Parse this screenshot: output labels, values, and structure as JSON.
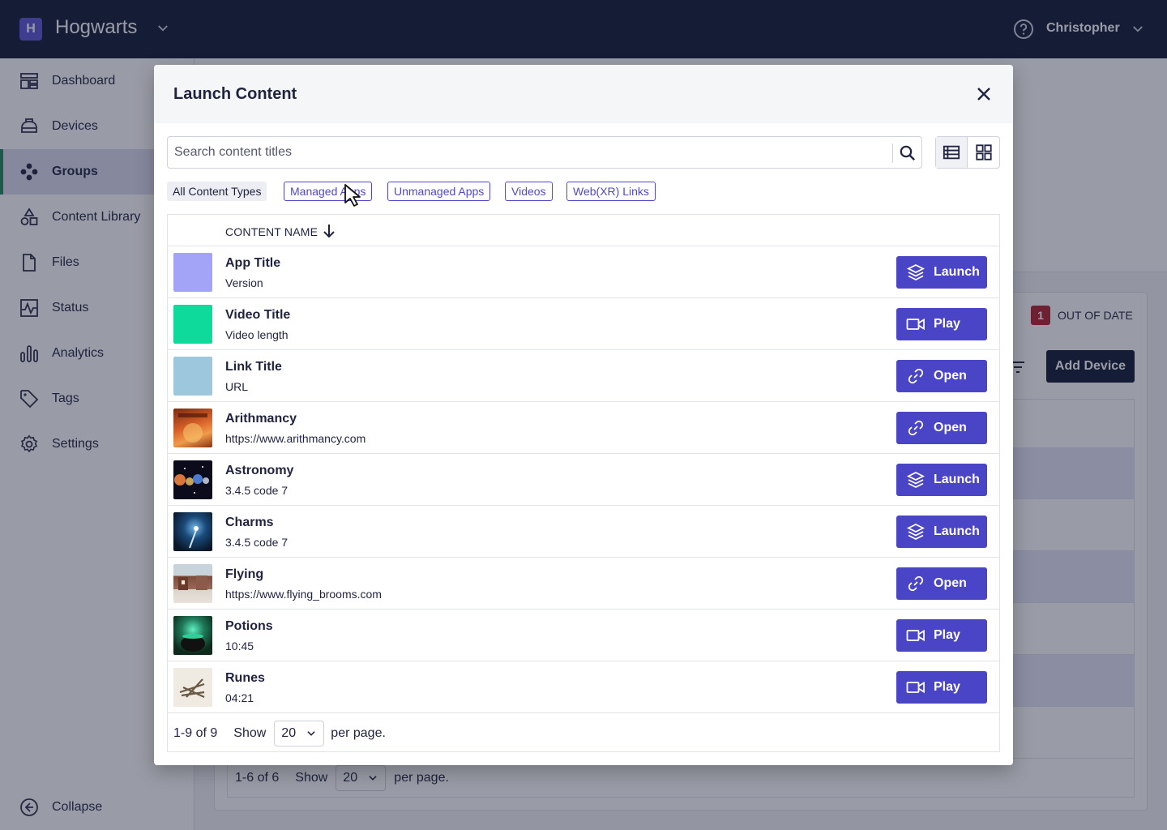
{
  "topbar": {
    "org_initial": "H",
    "org_name": "Hogwarts",
    "user_name": "Christopher"
  },
  "sidebar": {
    "items": [
      {
        "label": "Dashboard",
        "icon": "dashboard-icon"
      },
      {
        "label": "Devices",
        "icon": "devices-icon"
      },
      {
        "label": "Groups",
        "icon": "groups-icon",
        "active": true
      },
      {
        "label": "Content Library",
        "icon": "content-library-icon"
      },
      {
        "label": "Files",
        "icon": "file-icon"
      },
      {
        "label": "Status",
        "icon": "status-icon"
      },
      {
        "label": "Analytics",
        "icon": "analytics-icon"
      },
      {
        "label": "Tags",
        "icon": "tag-icon"
      },
      {
        "label": "Settings",
        "icon": "gear-icon"
      }
    ],
    "collapse_label": "Collapse"
  },
  "background": {
    "out_of_date_count": "1",
    "out_of_date_label": "OUT OF DATE",
    "add_device_label": "Add Device",
    "pager_range": "1-6 of 6",
    "pager_show": "Show",
    "pager_value": "20",
    "pager_suffix": "per page."
  },
  "modal": {
    "title": "Launch Content",
    "search_placeholder": "Search content titles",
    "filters": [
      {
        "label": "All Content Types",
        "active": true
      },
      {
        "label": "Managed Apps"
      },
      {
        "label": "Unmanaged Apps"
      },
      {
        "label": "Videos"
      },
      {
        "label": "Web(XR) Links"
      }
    ],
    "column_header": "CONTENT NAME",
    "rows": [
      {
        "title": "App Title",
        "subtitle": "Version",
        "action": "Launch",
        "action_icon": "layers-icon",
        "thumb_color": "#a3a3f7"
      },
      {
        "title": "Video Title",
        "subtitle": "Video length",
        "action": "Play",
        "action_icon": "video-icon",
        "thumb_color": "#0edb9b"
      },
      {
        "title": "Link Title",
        "subtitle": "URL",
        "action": "Open",
        "action_icon": "link-icon",
        "thumb_color": "#9cc7dc"
      },
      {
        "title": "Arithmancy",
        "subtitle": "https://www.arithmancy.com",
        "action": "Open",
        "action_icon": "link-icon",
        "thumb_color": "#c9521b"
      },
      {
        "title": "Astronomy",
        "subtitle": "3.4.5 code 7",
        "action": "Launch",
        "action_icon": "layers-icon",
        "thumb_color": "#1a1a2e"
      },
      {
        "title": "Charms",
        "subtitle": "3.4.5 code 7",
        "action": "Launch",
        "action_icon": "layers-icon",
        "thumb_color": "#0f2a44"
      },
      {
        "title": "Flying",
        "subtitle": "https://www.flying_brooms.com",
        "action": "Open",
        "action_icon": "link-icon",
        "thumb_color": "#8a6a5a"
      },
      {
        "title": "Potions",
        "subtitle": "10:45",
        "action": "Play",
        "action_icon": "video-icon",
        "thumb_color": "#1e4a2e"
      },
      {
        "title": "Runes",
        "subtitle": "04:21",
        "action": "Play",
        "action_icon": "video-icon",
        "thumb_color": "#d8cfc2"
      }
    ],
    "pager_range": "1-9 of 9",
    "pager_show": "Show",
    "pager_value": "20",
    "pager_suffix": "per page."
  },
  "colors": {
    "topbar": "#101b33",
    "accent": "#4a44c6",
    "active_nav_border": "#1d8a5a",
    "badge_red": "#b3202f"
  }
}
